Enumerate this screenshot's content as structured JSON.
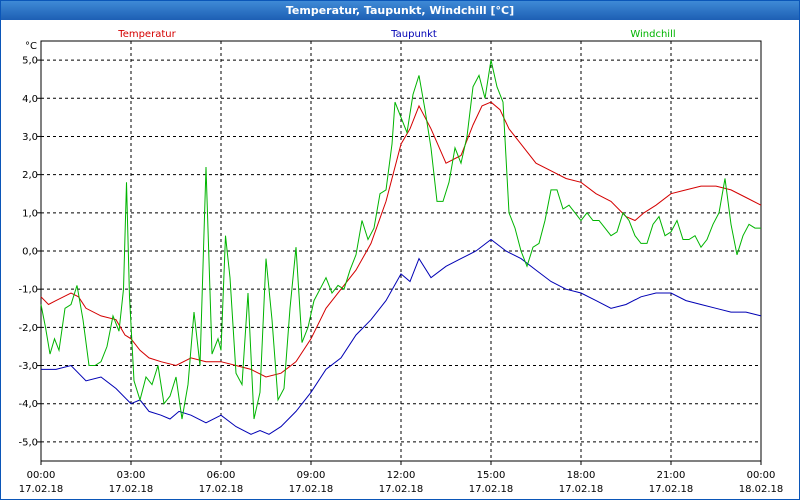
{
  "window": {
    "title": "Temperatur, Taupunkt, Windchill [°C]"
  },
  "chart_data": {
    "type": "line",
    "title": "Temperatur, Taupunkt, Windchill [°C]",
    "ylabel": "°C",
    "ylim": [
      -5.5,
      5.5
    ],
    "y_ticks": [
      "5,0",
      "4,0",
      "3,0",
      "2,0",
      "1,0",
      "0,0",
      "-1,0",
      "-2,0",
      "-3,0",
      "-4,0",
      "-5,0"
    ],
    "x_ticks": [
      {
        "time": "00:00",
        "date": "17.02.18"
      },
      {
        "time": "03:00",
        "date": "17.02.18"
      },
      {
        "time": "06:00",
        "date": "17.02.18"
      },
      {
        "time": "09:00",
        "date": "17.02.18"
      },
      {
        "time": "12:00",
        "date": "17.02.18"
      },
      {
        "time": "15:00",
        "date": "17.02.18"
      },
      {
        "time": "18:00",
        "date": "17.02.18"
      },
      {
        "time": "21:00",
        "date": "17.02.18"
      },
      {
        "time": "00:00",
        "date": "18.02.18"
      }
    ],
    "x_unit": "hours since 17.02.18 00:00",
    "xlim": [
      0,
      24
    ],
    "grid": true,
    "colors": {
      "Temperatur": "#d40000",
      "Taupunkt": "#0000b4",
      "Windchill": "#00b400"
    },
    "series": [
      {
        "name": "Temperatur",
        "color": "#d40000",
        "points": [
          [
            0.0,
            -1.2
          ],
          [
            0.25,
            -1.4
          ],
          [
            0.5,
            -1.3
          ],
          [
            0.75,
            -1.2
          ],
          [
            1.0,
            -1.1
          ],
          [
            1.25,
            -1.2
          ],
          [
            1.5,
            -1.5
          ],
          [
            2.0,
            -1.7
          ],
          [
            2.5,
            -1.8
          ],
          [
            2.8,
            -2.2
          ],
          [
            3.0,
            -2.3
          ],
          [
            3.3,
            -2.6
          ],
          [
            3.6,
            -2.8
          ],
          [
            4.0,
            -2.9
          ],
          [
            4.5,
            -3.0
          ],
          [
            5.0,
            -2.8
          ],
          [
            5.5,
            -2.9
          ],
          [
            6.0,
            -2.9
          ],
          [
            6.5,
            -3.0
          ],
          [
            7.0,
            -3.1
          ],
          [
            7.5,
            -3.3
          ],
          [
            8.0,
            -3.2
          ],
          [
            8.5,
            -2.9
          ],
          [
            9.0,
            -2.3
          ],
          [
            9.5,
            -1.5
          ],
          [
            10.0,
            -1.0
          ],
          [
            10.5,
            -0.5
          ],
          [
            11.0,
            0.2
          ],
          [
            11.5,
            1.3
          ],
          [
            12.0,
            2.8
          ],
          [
            12.3,
            3.2
          ],
          [
            12.6,
            3.8
          ],
          [
            13.0,
            3.2
          ],
          [
            13.5,
            2.3
          ],
          [
            14.0,
            2.5
          ],
          [
            14.4,
            3.3
          ],
          [
            14.7,
            3.8
          ],
          [
            15.0,
            3.9
          ],
          [
            15.3,
            3.7
          ],
          [
            15.6,
            3.2
          ],
          [
            16.0,
            2.8
          ],
          [
            16.5,
            2.3
          ],
          [
            17.0,
            2.1
          ],
          [
            17.5,
            1.9
          ],
          [
            18.0,
            1.8
          ],
          [
            18.5,
            1.5
          ],
          [
            19.0,
            1.3
          ],
          [
            19.5,
            0.9
          ],
          [
            19.8,
            0.8
          ],
          [
            20.1,
            1.0
          ],
          [
            20.5,
            1.2
          ],
          [
            21.0,
            1.5
          ],
          [
            21.5,
            1.6
          ],
          [
            22.0,
            1.7
          ],
          [
            22.5,
            1.7
          ],
          [
            23.0,
            1.6
          ],
          [
            23.5,
            1.4
          ],
          [
            24.0,
            1.2
          ]
        ]
      },
      {
        "name": "Taupunkt",
        "color": "#0000b4",
        "points": [
          [
            0.0,
            -3.1
          ],
          [
            0.5,
            -3.1
          ],
          [
            1.0,
            -3.0
          ],
          [
            1.5,
            -3.4
          ],
          [
            2.0,
            -3.3
          ],
          [
            2.5,
            -3.6
          ],
          [
            3.0,
            -4.0
          ],
          [
            3.3,
            -3.9
          ],
          [
            3.6,
            -4.2
          ],
          [
            4.0,
            -4.3
          ],
          [
            4.3,
            -4.4
          ],
          [
            4.6,
            -4.2
          ],
          [
            5.0,
            -4.3
          ],
          [
            5.5,
            -4.5
          ],
          [
            6.0,
            -4.3
          ],
          [
            6.5,
            -4.6
          ],
          [
            7.0,
            -4.8
          ],
          [
            7.3,
            -4.7
          ],
          [
            7.6,
            -4.8
          ],
          [
            8.0,
            -4.6
          ],
          [
            8.5,
            -4.2
          ],
          [
            9.0,
            -3.7
          ],
          [
            9.5,
            -3.1
          ],
          [
            10.0,
            -2.8
          ],
          [
            10.5,
            -2.2
          ],
          [
            11.0,
            -1.8
          ],
          [
            11.5,
            -1.3
          ],
          [
            12.0,
            -0.6
          ],
          [
            12.3,
            -0.8
          ],
          [
            12.6,
            -0.2
          ],
          [
            13.0,
            -0.7
          ],
          [
            13.5,
            -0.4
          ],
          [
            14.0,
            -0.2
          ],
          [
            14.5,
            0.0
          ],
          [
            15.0,
            0.3
          ],
          [
            15.5,
            0.0
          ],
          [
            16.0,
            -0.2
          ],
          [
            16.5,
            -0.5
          ],
          [
            17.0,
            -0.8
          ],
          [
            17.5,
            -1.0
          ],
          [
            18.0,
            -1.1
          ],
          [
            18.5,
            -1.3
          ],
          [
            19.0,
            -1.5
          ],
          [
            19.5,
            -1.4
          ],
          [
            20.0,
            -1.2
          ],
          [
            20.5,
            -1.1
          ],
          [
            21.0,
            -1.1
          ],
          [
            21.5,
            -1.3
          ],
          [
            22.0,
            -1.4
          ],
          [
            22.5,
            -1.5
          ],
          [
            23.0,
            -1.6
          ],
          [
            23.5,
            -1.6
          ],
          [
            24.0,
            -1.7
          ]
        ]
      },
      {
        "name": "Windchill",
        "color": "#00b400",
        "points": [
          [
            0.0,
            -1.4
          ],
          [
            0.15,
            -2.0
          ],
          [
            0.3,
            -2.7
          ],
          [
            0.45,
            -2.3
          ],
          [
            0.6,
            -2.6
          ],
          [
            0.8,
            -1.5
          ],
          [
            1.0,
            -1.4
          ],
          [
            1.2,
            -0.9
          ],
          [
            1.4,
            -1.8
          ],
          [
            1.6,
            -3.0
          ],
          [
            1.8,
            -3.0
          ],
          [
            2.0,
            -2.9
          ],
          [
            2.2,
            -2.5
          ],
          [
            2.4,
            -1.7
          ],
          [
            2.6,
            -2.1
          ],
          [
            2.75,
            -1.0
          ],
          [
            2.85,
            1.8
          ],
          [
            2.95,
            -1.2
          ],
          [
            3.1,
            -3.4
          ],
          [
            3.3,
            -3.9
          ],
          [
            3.5,
            -3.3
          ],
          [
            3.7,
            -3.5
          ],
          [
            3.9,
            -3.0
          ],
          [
            4.1,
            -4.0
          ],
          [
            4.3,
            -3.8
          ],
          [
            4.5,
            -3.3
          ],
          [
            4.7,
            -4.4
          ],
          [
            4.9,
            -3.5
          ],
          [
            5.1,
            -1.6
          ],
          [
            5.3,
            -3.0
          ],
          [
            5.5,
            2.2
          ],
          [
            5.7,
            -2.7
          ],
          [
            5.9,
            -2.3
          ],
          [
            6.0,
            -2.6
          ],
          [
            6.15,
            0.4
          ],
          [
            6.3,
            -0.7
          ],
          [
            6.5,
            -3.2
          ],
          [
            6.7,
            -3.5
          ],
          [
            6.9,
            -1.1
          ],
          [
            7.1,
            -4.4
          ],
          [
            7.3,
            -3.7
          ],
          [
            7.5,
            -0.2
          ],
          [
            7.7,
            -1.8
          ],
          [
            7.9,
            -3.9
          ],
          [
            8.1,
            -3.6
          ],
          [
            8.3,
            -1.5
          ],
          [
            8.5,
            0.1
          ],
          [
            8.7,
            -2.4
          ],
          [
            8.9,
            -2.0
          ],
          [
            9.1,
            -1.3
          ],
          [
            9.3,
            -1.0
          ],
          [
            9.5,
            -0.7
          ],
          [
            9.7,
            -1.1
          ],
          [
            9.9,
            -0.9
          ],
          [
            10.1,
            -1.0
          ],
          [
            10.3,
            -0.5
          ],
          [
            10.5,
            -0.1
          ],
          [
            10.7,
            0.8
          ],
          [
            10.9,
            0.3
          ],
          [
            11.1,
            0.6
          ],
          [
            11.3,
            1.5
          ],
          [
            11.5,
            1.6
          ],
          [
            11.7,
            2.8
          ],
          [
            11.8,
            3.9
          ],
          [
            12.0,
            3.5
          ],
          [
            12.2,
            3.1
          ],
          [
            12.4,
            4.1
          ],
          [
            12.6,
            4.6
          ],
          [
            12.8,
            3.7
          ],
          [
            13.0,
            2.7
          ],
          [
            13.2,
            1.3
          ],
          [
            13.4,
            1.3
          ],
          [
            13.6,
            1.8
          ],
          [
            13.8,
            2.7
          ],
          [
            14.0,
            2.3
          ],
          [
            14.2,
            3.0
          ],
          [
            14.4,
            4.3
          ],
          [
            14.6,
            4.6
          ],
          [
            14.8,
            4.0
          ],
          [
            15.0,
            5.0
          ],
          [
            15.2,
            4.3
          ],
          [
            15.4,
            3.9
          ],
          [
            15.6,
            1.0
          ],
          [
            15.8,
            0.6
          ],
          [
            16.0,
            0.0
          ],
          [
            16.2,
            -0.4
          ],
          [
            16.4,
            0.1
          ],
          [
            16.6,
            0.2
          ],
          [
            16.8,
            0.8
          ],
          [
            17.0,
            1.6
          ],
          [
            17.2,
            1.6
          ],
          [
            17.4,
            1.1
          ],
          [
            17.6,
            1.2
          ],
          [
            17.8,
            1.0
          ],
          [
            18.0,
            0.8
          ],
          [
            18.2,
            1.0
          ],
          [
            18.4,
            0.8
          ],
          [
            18.6,
            0.8
          ],
          [
            18.8,
            0.6
          ],
          [
            19.0,
            0.4
          ],
          [
            19.2,
            0.5
          ],
          [
            19.4,
            1.0
          ],
          [
            19.6,
            0.8
          ],
          [
            19.8,
            0.4
          ],
          [
            20.0,
            0.2
          ],
          [
            20.2,
            0.2
          ],
          [
            20.4,
            0.7
          ],
          [
            20.6,
            0.9
          ],
          [
            20.8,
            0.4
          ],
          [
            21.0,
            0.5
          ],
          [
            21.2,
            0.8
          ],
          [
            21.4,
            0.3
          ],
          [
            21.6,
            0.3
          ],
          [
            21.8,
            0.4
          ],
          [
            22.0,
            0.1
          ],
          [
            22.2,
            0.3
          ],
          [
            22.4,
            0.7
          ],
          [
            22.6,
            1.0
          ],
          [
            22.8,
            1.9
          ],
          [
            23.0,
            0.7
          ],
          [
            23.2,
            -0.1
          ],
          [
            23.4,
            0.4
          ],
          [
            23.6,
            0.7
          ],
          [
            23.8,
            0.6
          ],
          [
            24.0,
            0.6
          ]
        ]
      }
    ],
    "legend_placement": "top"
  }
}
